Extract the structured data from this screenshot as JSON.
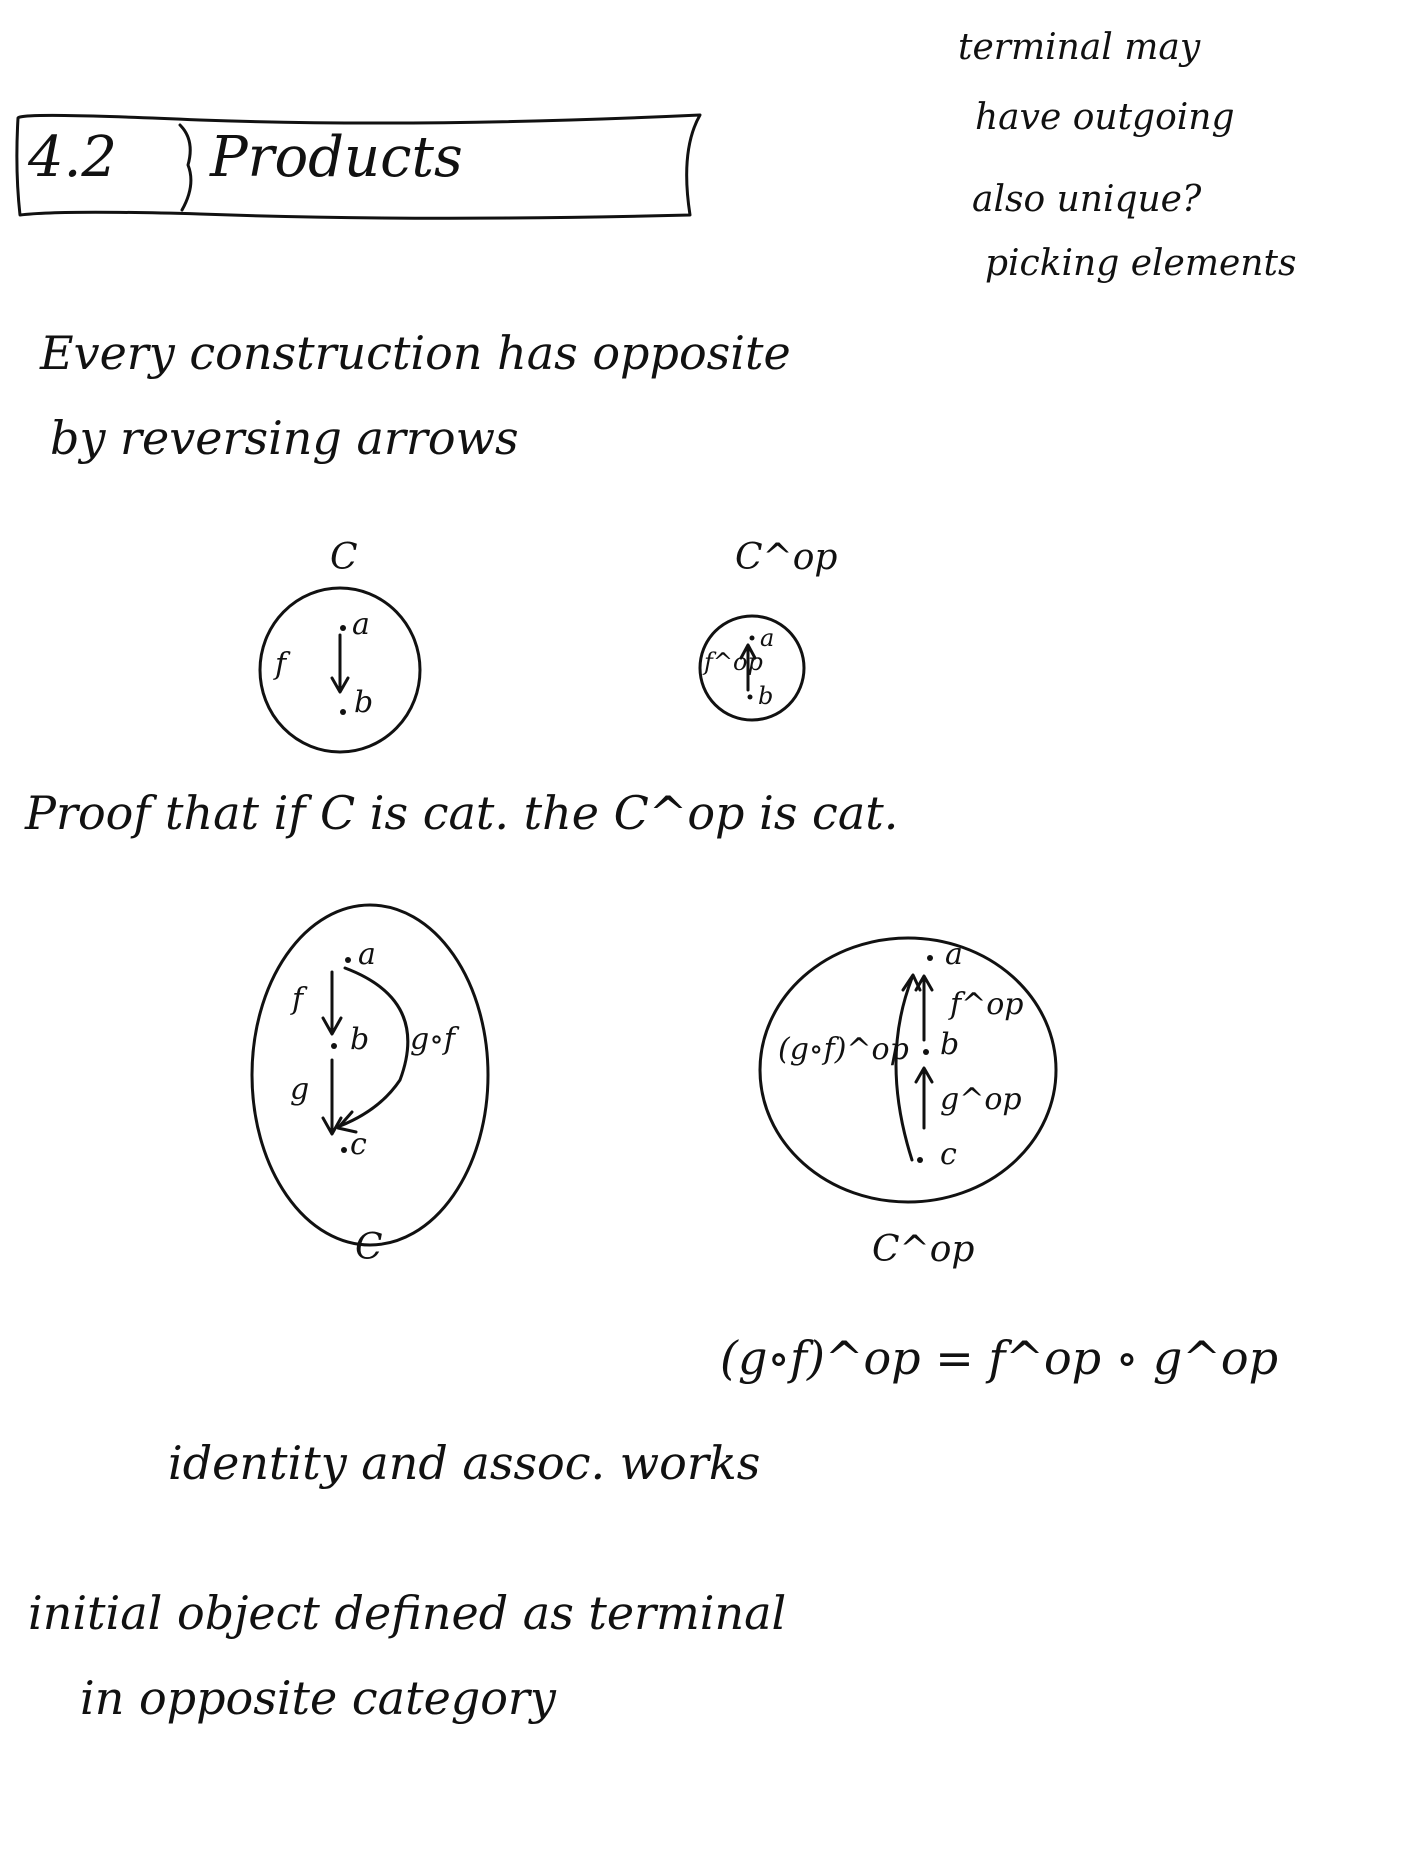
{
  "side_note": {
    "lines": [
      "terminal may",
      "have outgoing",
      "also unique?",
      "picking elements"
    ]
  },
  "section": {
    "number": "4.2",
    "title": "Products"
  },
  "intro": {
    "lines": [
      "Every construction has opposite",
      "by reversing arrows"
    ]
  },
  "diagram1": {
    "left": {
      "category": "C",
      "object_a": "a",
      "object_b": "b",
      "arrow": "f"
    },
    "right": {
      "category": "C^op",
      "object_a": "a",
      "object_b": "b",
      "arrow": "f^op"
    }
  },
  "proof_heading": "Proof that if C is cat. the C^op is cat.",
  "diagram2": {
    "left": {
      "category": "C",
      "a": "a",
      "b": "b",
      "c": "c",
      "f": "f",
      "g": "g",
      "composite": "g∘f"
    },
    "right": {
      "category": "C^op",
      "a": "a",
      "b": "b",
      "c": "c",
      "f_op": "f^op",
      "g_op": "g^op",
      "composite": "(g∘f)^op"
    }
  },
  "equation": "(g∘f)^op = f^op ∘ g^op",
  "identity_note": "identity and assoc. works",
  "conclusion": {
    "lines": [
      "initial object defined as terminal",
      "in opposite category"
    ]
  }
}
